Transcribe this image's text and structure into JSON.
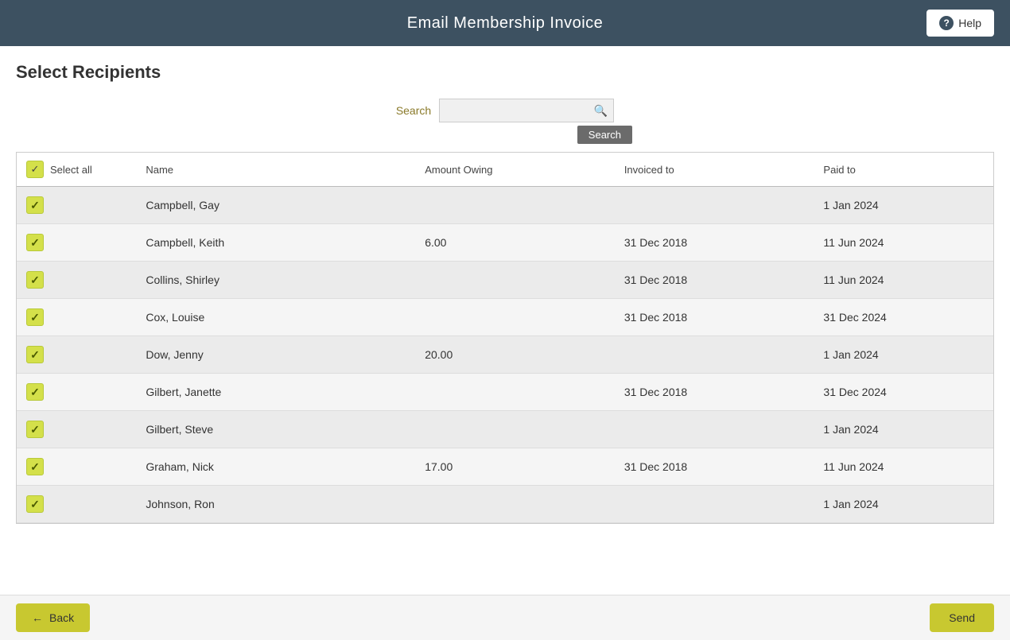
{
  "header": {
    "title": "Email Membership Invoice",
    "help_label": "Help"
  },
  "page": {
    "title": "Select Recipients"
  },
  "search": {
    "label": "Search",
    "placeholder": "",
    "button_label": "Search"
  },
  "table": {
    "select_all_label": "Select all",
    "columns": [
      "Name",
      "Amount Owing",
      "Invoiced to",
      "Paid to"
    ],
    "rows": [
      {
        "checked": true,
        "name": "Campbell, Gay",
        "amount": "",
        "invoiced_to": "",
        "paid_to": "1 Jan 2024"
      },
      {
        "checked": true,
        "name": "Campbell, Keith",
        "amount": "6.00",
        "invoiced_to": "31 Dec 2018",
        "paid_to": "11 Jun 2024"
      },
      {
        "checked": true,
        "name": "Collins, Shirley",
        "amount": "",
        "invoiced_to": "31 Dec 2018",
        "paid_to": "11 Jun 2024"
      },
      {
        "checked": true,
        "name": "Cox, Louise",
        "amount": "",
        "invoiced_to": "31 Dec 2018",
        "paid_to": "31 Dec 2024"
      },
      {
        "checked": true,
        "name": "Dow, Jenny",
        "amount": "20.00",
        "invoiced_to": "",
        "paid_to": "1 Jan 2024"
      },
      {
        "checked": true,
        "name": "Gilbert, Janette",
        "amount": "",
        "invoiced_to": "31 Dec 2018",
        "paid_to": "31 Dec 2024"
      },
      {
        "checked": true,
        "name": "Gilbert, Steve",
        "amount": "",
        "invoiced_to": "",
        "paid_to": "1 Jan 2024"
      },
      {
        "checked": true,
        "name": "Graham, Nick",
        "amount": "17.00",
        "invoiced_to": "31 Dec 2018",
        "paid_to": "11 Jun 2024"
      },
      {
        "checked": true,
        "name": "Johnson, Ron",
        "amount": "",
        "invoiced_to": "",
        "paid_to": "1 Jan 2024"
      }
    ]
  },
  "footer": {
    "back_label": "Back",
    "send_label": "Send"
  }
}
